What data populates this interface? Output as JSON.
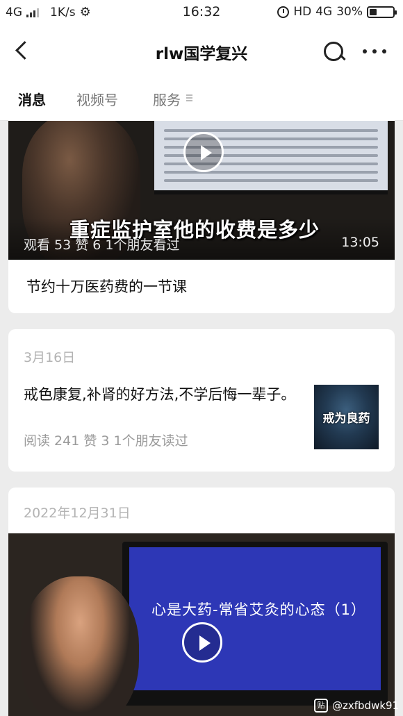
{
  "status_bar": {
    "network_left": "4G",
    "speed": "1K/s",
    "time": "16:32",
    "hd": "HD",
    "network_right": "4G",
    "battery": "30%",
    "battery_level": 0.3
  },
  "nav": {
    "title": "rlw国学复兴"
  },
  "tabs": [
    {
      "label": "消息",
      "active": true
    },
    {
      "label": "视频号",
      "active": false
    },
    {
      "label": "服务",
      "active": false
    }
  ],
  "card1": {
    "video_caption": "重症监护室他的收费是多少",
    "stats": "观看 53  赞 6  1个朋友看过",
    "duration": "13:05",
    "title": "节约十万医药费的一节课"
  },
  "card2": {
    "date": "3月16日",
    "title": "戒色康复,补肾的好方法,不学后悔一辈子。",
    "meta": "阅读 241  赞 3  1个朋友读过",
    "thumb_text": "戒为良药"
  },
  "card3": {
    "date": "2022年12月31日",
    "screen_text": "心是大药-常省艾灸的心态（1）"
  },
  "watermark": {
    "logo": "贴",
    "handle": "@zxfbdwk91"
  }
}
